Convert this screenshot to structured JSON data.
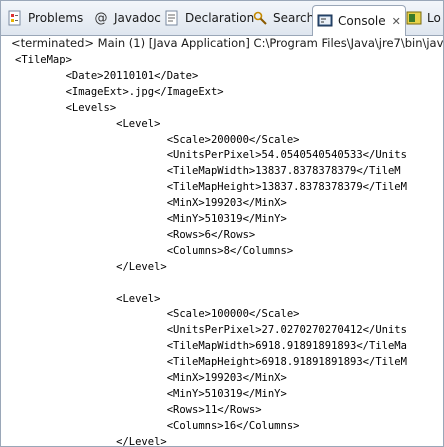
{
  "tabs": [
    {
      "label": "Problems",
      "icon": "problems-icon"
    },
    {
      "label": "Javadoc",
      "icon": "at-icon"
    },
    {
      "label": "Declaration",
      "icon": "declaration-icon"
    },
    {
      "label": "Search",
      "icon": "search-icon"
    },
    {
      "label": "Console",
      "icon": "console-icon",
      "active": true
    },
    {
      "label": "Lo",
      "icon": "log-icon"
    }
  ],
  "console": {
    "status": "<terminated> Main (1) [Java Application] C:\\Program Files\\Java\\jre7\\bin\\javi",
    "lines": [
      "<TileMap>",
      "        <Date>20110101</Date>",
      "        <ImageExt>.jpg</ImageExt>",
      "        <Levels>",
      "                <Level>",
      "                        <Scale>200000</Scale>",
      "                        <UnitsPerPixel>54.0540540540533</Units",
      "                        <TileMapWidth>13837.8378378379</TileM",
      "                        <TileMapHeight>13837.8378378379</TileM",
      "                        <MinX>199203</MinX>",
      "                        <MinY>510319</MinY>",
      "                        <Rows>6</Rows>",
      "                        <Columns>8</Columns>",
      "                </Level>",
      "",
      "                <Level>",
      "                        <Scale>100000</Scale>",
      "                        <UnitsPerPixel>27.0270270270412</Units",
      "                        <TileMapWidth>6918.91891891893</TileMa",
      "                        <TileMapHeight>6918.91891891893</TileM",
      "                        <MinX>199203</MinX>",
      "                        <MinY>510319</MinY>",
      "                        <Rows>11</Rows>",
      "                        <Columns>16</Columns>",
      "                </Level>"
    ]
  }
}
